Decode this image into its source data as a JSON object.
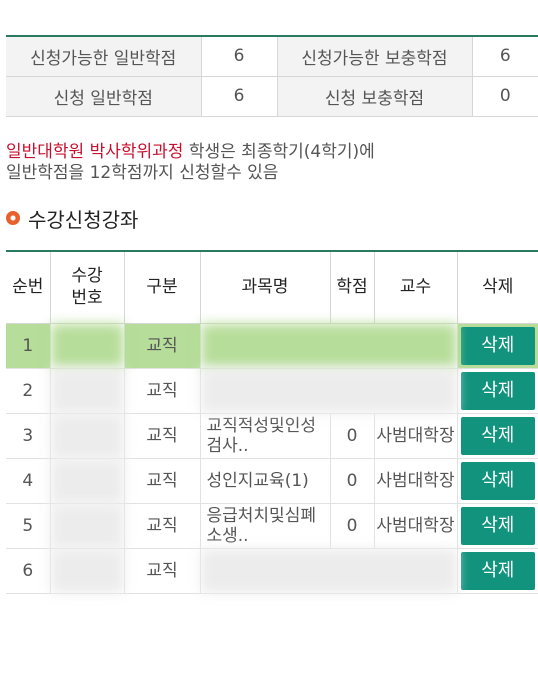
{
  "summary": {
    "rows": [
      {
        "label_a": "신청가능한 일반학점",
        "value_a": "6",
        "label_b": "신청가능한 보충학점",
        "value_b": "6"
      },
      {
        "label_a": "신청 일반학점",
        "value_a": "6",
        "label_b": "신청 보충학점",
        "value_b": "0"
      }
    ]
  },
  "notice": {
    "highlight": "일반대학원 박사학위과정",
    "text_rest": " 학생은 최종학기(4학기)에",
    "line2": "일반학점을 12학점까지 신청할수 있음"
  },
  "section_title": "수강신청강좌",
  "table": {
    "headers": [
      "순번",
      "수강\n번호",
      "구분",
      "과목명",
      "학점",
      "교수",
      "삭제"
    ],
    "rows": [
      {
        "no": "1",
        "code": "",
        "type": "교직",
        "name": "",
        "credit": "",
        "prof": "",
        "action": "삭제"
      },
      {
        "no": "2",
        "code": "",
        "type": "교직",
        "name": "",
        "credit": "",
        "prof": "",
        "action": "삭제"
      },
      {
        "no": "3",
        "code": "",
        "type": "교직",
        "name": "교직적성및인성검사..",
        "credit": "0",
        "prof": "사범대학장",
        "action": "삭제"
      },
      {
        "no": "4",
        "code": "",
        "type": "교직",
        "name": "성인지교육(1)",
        "credit": "0",
        "prof": "사범대학장",
        "action": "삭제"
      },
      {
        "no": "5",
        "code": "",
        "type": "교직",
        "name": "응급처치및심폐소생..",
        "credit": "0",
        "prof": "사범대학장",
        "action": "삭제"
      },
      {
        "no": "6",
        "code": "",
        "type": "교직",
        "name": "",
        "credit": "",
        "prof": "",
        "action": "삭제"
      }
    ]
  }
}
